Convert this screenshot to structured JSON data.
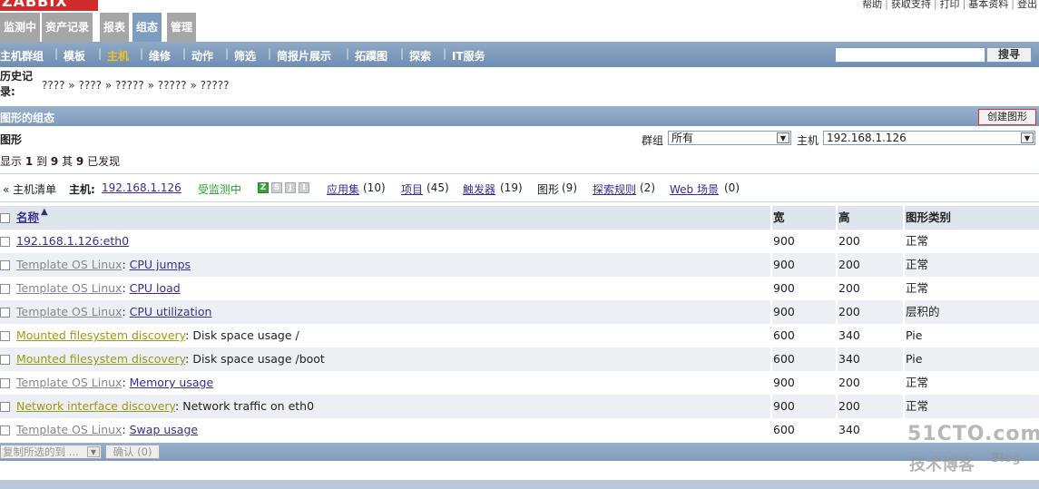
{
  "header": {
    "logo": "ZABBIX",
    "top_links": [
      "帮助",
      "获取支持",
      "打印",
      "基本资料",
      "登出"
    ]
  },
  "main_menu": [
    {
      "label": "监测中",
      "active": false
    },
    {
      "label": "资产记录",
      "active": false
    },
    {
      "label": "报表",
      "active": false
    },
    {
      "label": "组态",
      "active": true
    },
    {
      "label": "管理",
      "active": false
    }
  ],
  "sub_menu": [
    {
      "label": "主机群组",
      "active": false
    },
    {
      "label": "模板",
      "active": false
    },
    {
      "label": "主机",
      "active": true
    },
    {
      "label": "维修",
      "active": false
    },
    {
      "label": "动作",
      "active": false
    },
    {
      "label": "筛选",
      "active": false
    },
    {
      "label": "简报片展示",
      "active": false
    },
    {
      "label": "拓蹼图",
      "active": false
    },
    {
      "label": "探索",
      "active": false
    },
    {
      "label": "IT服务",
      "active": false
    }
  ],
  "search": {
    "value": "",
    "button_label": "搜寻"
  },
  "history": {
    "label": "历史记录:",
    "crumbs": [
      "????",
      "????",
      "?????",
      "?????",
      "?????"
    ],
    "separator": "»"
  },
  "section": {
    "title": "图形的组态",
    "create_button": "创建图形"
  },
  "filter": {
    "title": "图形",
    "group_label": "群组",
    "group_value": "所有",
    "host_label": "主机",
    "host_value": "192.168.1.126"
  },
  "showing": {
    "prefix": "显示",
    "from": "1",
    "to_word": "到",
    "to": "9",
    "of_word": "其",
    "total": "9",
    "suffix": "已发现"
  },
  "host_nav": {
    "back_label": "« 主机清单",
    "host_prefix": "主机:",
    "host_link": "192.168.1.126",
    "status": "受监测中",
    "availability": [
      "Z",
      "S",
      "J",
      "I"
    ],
    "applications": {
      "label": "应用集",
      "count": "(10)"
    },
    "items": {
      "label": "项目",
      "count": "(45)"
    },
    "triggers": {
      "label": "触发器",
      "count": "(19)"
    },
    "graphs": {
      "label": "图形",
      "count": "(9)"
    },
    "discovery": {
      "label": "探索规则",
      "count": "(2)"
    },
    "web": {
      "label": "Web 场景",
      "count": "(0)"
    }
  },
  "table": {
    "columns": [
      "名称",
      "宽",
      "高",
      "图形类别"
    ],
    "rows": [
      {
        "prefix": "",
        "prefix_kind": "",
        "name": "192.168.1.126:eth0",
        "name_link": true,
        "width": "900",
        "height": "200",
        "type": "正常"
      },
      {
        "prefix": "Template OS Linux",
        "prefix_kind": "template",
        "name": "CPU jumps",
        "name_link": true,
        "width": "900",
        "height": "200",
        "type": "正常"
      },
      {
        "prefix": "Template OS Linux",
        "prefix_kind": "template",
        "name": "CPU load",
        "name_link": true,
        "width": "900",
        "height": "200",
        "type": "正常"
      },
      {
        "prefix": "Template OS Linux",
        "prefix_kind": "template",
        "name": "CPU utilization",
        "name_link": true,
        "width": "900",
        "height": "200",
        "type": "层积的"
      },
      {
        "prefix": "Mounted filesystem discovery",
        "prefix_kind": "discovery",
        "name": "Disk space usage /",
        "name_link": false,
        "width": "600",
        "height": "340",
        "type": "Pie"
      },
      {
        "prefix": "Mounted filesystem discovery",
        "prefix_kind": "discovery",
        "name": "Disk space usage /boot",
        "name_link": false,
        "width": "600",
        "height": "340",
        "type": "Pie"
      },
      {
        "prefix": "Template OS Linux",
        "prefix_kind": "template",
        "name": "Memory usage",
        "name_link": true,
        "width": "900",
        "height": "200",
        "type": "正常"
      },
      {
        "prefix": "Network interface discovery",
        "prefix_kind": "discovery",
        "name": "Network traffic on eth0",
        "name_link": false,
        "width": "900",
        "height": "200",
        "type": "正常"
      },
      {
        "prefix": "Template OS Linux",
        "prefix_kind": "template",
        "name": "Swap usage",
        "name_link": true,
        "width": "600",
        "height": "340",
        "type": ""
      }
    ]
  },
  "footer": {
    "action_select": "复制所选的到 ...",
    "confirm_button": "确认 (0)"
  },
  "watermark": {
    "main": "51CTO.com",
    "sub": "技术博客",
    "blog": "Blog"
  },
  "colors": {
    "active_tab": "#7d9cc0",
    "submenu_active": "#f3c020",
    "status_green": "#2a9a2a",
    "template_grey": "#888888",
    "discovery_olive": "#9a9a1a"
  }
}
